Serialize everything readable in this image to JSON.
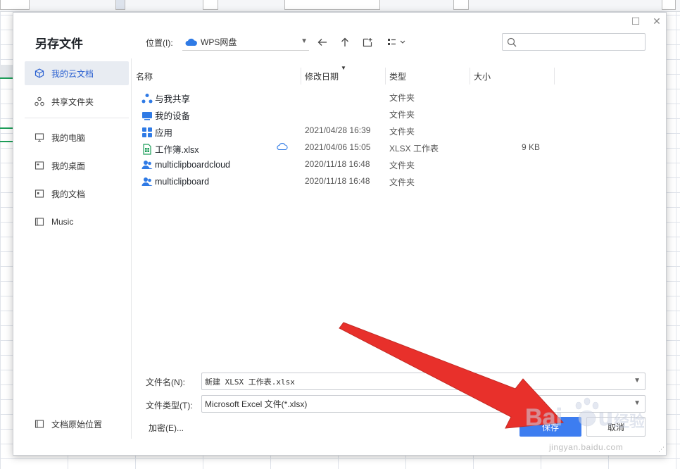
{
  "dialog": {
    "title": "另存文件",
    "sidebar": {
      "items": [
        {
          "label": "我的云文档",
          "icon": "cube-icon",
          "active": true
        },
        {
          "label": "共享文件夹",
          "icon": "share-nodes-icon"
        },
        {
          "label": "我的电脑",
          "icon": "monitor-icon"
        },
        {
          "label": "我的桌面",
          "icon": "desktop-icon"
        },
        {
          "label": "我的文档",
          "icon": "document-icon"
        },
        {
          "label": "Music",
          "icon": "folder-icon"
        }
      ],
      "bottom_item": {
        "label": "文档原始位置",
        "icon": "folder-icon"
      }
    },
    "location": {
      "label": "位置(I):",
      "value": "WPS网盘"
    },
    "columns": {
      "name": "名称",
      "modified": "修改日期",
      "type": "类型",
      "size": "大小"
    },
    "files": [
      {
        "name": "与我共享",
        "date": "",
        "type": "文件夹",
        "size": "",
        "icon": "share-folder-icon"
      },
      {
        "name": "我的设备",
        "date": "",
        "type": "文件夹",
        "size": "",
        "icon": "device-icon"
      },
      {
        "name": "应用",
        "date": "2021/04/28 16:39",
        "type": "文件夹",
        "size": "",
        "icon": "apps-icon"
      },
      {
        "name": "工作簿.xlsx",
        "date": "2021/04/06 15:05",
        "type": "XLSX 工作表",
        "size": "9 KB",
        "icon": "spreadsheet-icon"
      },
      {
        "name": "multiclipboardcloud",
        "date": "2020/11/18 16:48",
        "type": "文件夹",
        "size": "",
        "icon": "user-folder-icon"
      },
      {
        "name": "multiclipboard",
        "date": "2020/11/18 16:48",
        "type": "文件夹",
        "size": "",
        "icon": "user-folder-icon"
      }
    ],
    "filename": {
      "label": "文件名(N):",
      "value": "新建 XLSX 工作表.xlsx"
    },
    "filetype": {
      "label": "文件类型(T):",
      "value": "Microsoft Excel 文件(*.xlsx)"
    },
    "encrypt_label": "加密(E)...",
    "save_button": "保存",
    "cancel_button": "取消"
  },
  "watermark": {
    "url": "jingyan.baidu.com"
  },
  "colors": {
    "accent": "#3d7df0",
    "sidebar_active_bg": "#e8ecf2",
    "arrow": "#e8302b"
  }
}
